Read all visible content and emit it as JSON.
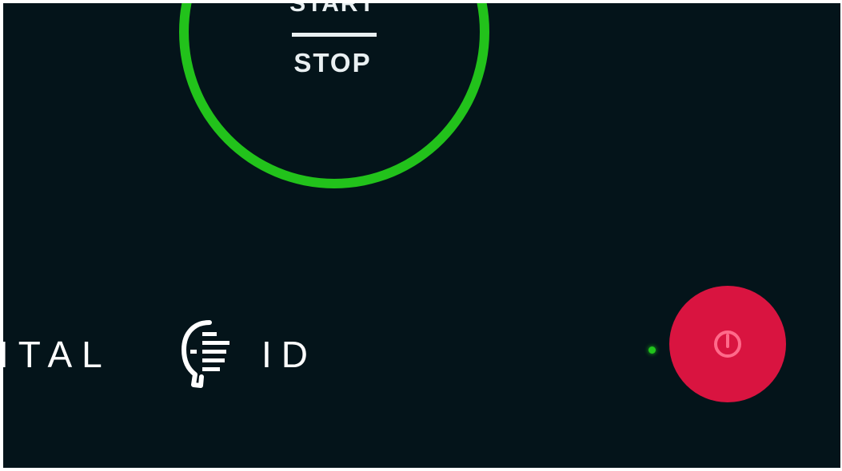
{
  "control": {
    "start_label": "START",
    "stop_label": "STOP",
    "ring_color": "#22c21b"
  },
  "brand": {
    "text_left": "ITAL",
    "text_right": "ID",
    "logo_icon": "face-scan-icon"
  },
  "status": {
    "indicator_color": "#21c41c"
  },
  "power": {
    "icon": "power-icon",
    "color": "#d91440"
  },
  "colors": {
    "background": "#04141a",
    "text": "#eaf0f2"
  }
}
